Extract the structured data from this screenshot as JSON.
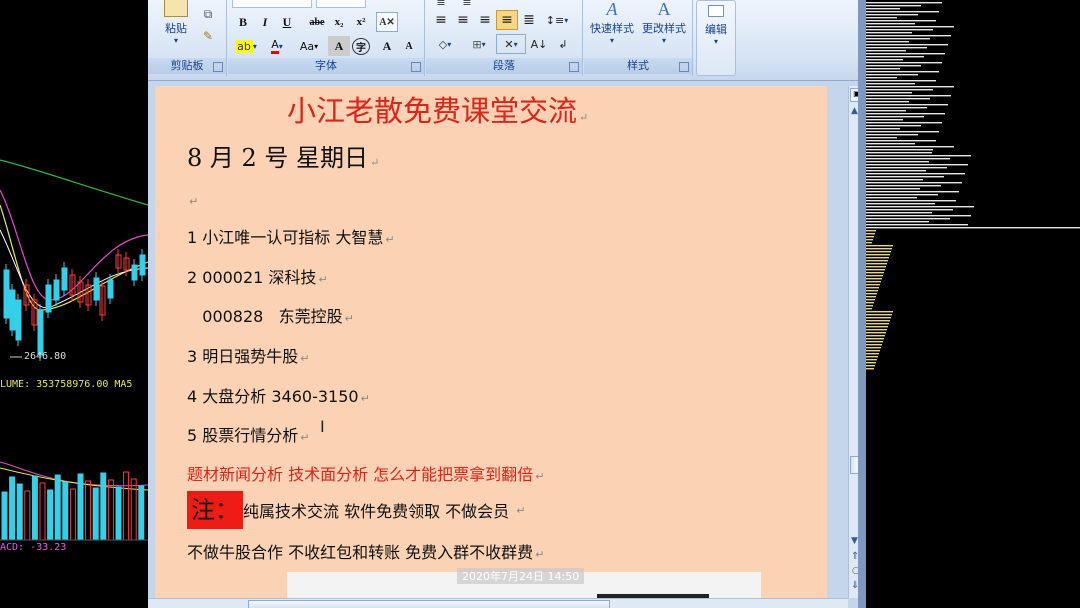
{
  "stock": {
    "low_price_label": "2646.80",
    "volume_label": "LUME: 353758976.00 MA5",
    "macd_label": "ACD: -33.23"
  },
  "ribbon": {
    "clipboard": {
      "paste_label": "粘贴",
      "group_label": "剪贴板"
    },
    "font": {
      "group_label": "字体",
      "bold": "B",
      "italic": "I",
      "underline": "U",
      "strike": "abe",
      "sub": "x₂",
      "sup": "x²",
      "aa": "Aa",
      "grow": "A",
      "shrink": "A"
    },
    "paragraph": {
      "group_label": "段落"
    },
    "styles": {
      "quick_styles_label": "快速样式",
      "change_styles_label": "更改样式",
      "group_label": "样式"
    },
    "editing": {
      "edit_label": "编辑"
    }
  },
  "document": {
    "title": "小江老散免费课堂交流",
    "date": "8 月 2 号  星期日",
    "lines": [
      "1  小江唯一认可指标   大智慧",
      "2 000021    深科技",
      "   000828   东莞控股",
      "3 明日强势牛股",
      "4 大盘分析 3460-3150",
      "5 股票行情分析"
    ],
    "red_line": "题材新闻分析   技术面分析  怎么才能把票拿到翻倍",
    "note_label": "注：",
    "note_text": "纯属技术交流 软件免费领取  不做会员 ",
    "last_line": "不做牛股合作  不收红包和转账  免费入群不收群费",
    "image_timestamp": "2020年7月24日 14:50",
    "para_mark": "↵"
  },
  "colors": {
    "page_bg": "#fbd3b4",
    "title_red": "#e0231a",
    "note_bg": "#ee1c14"
  }
}
